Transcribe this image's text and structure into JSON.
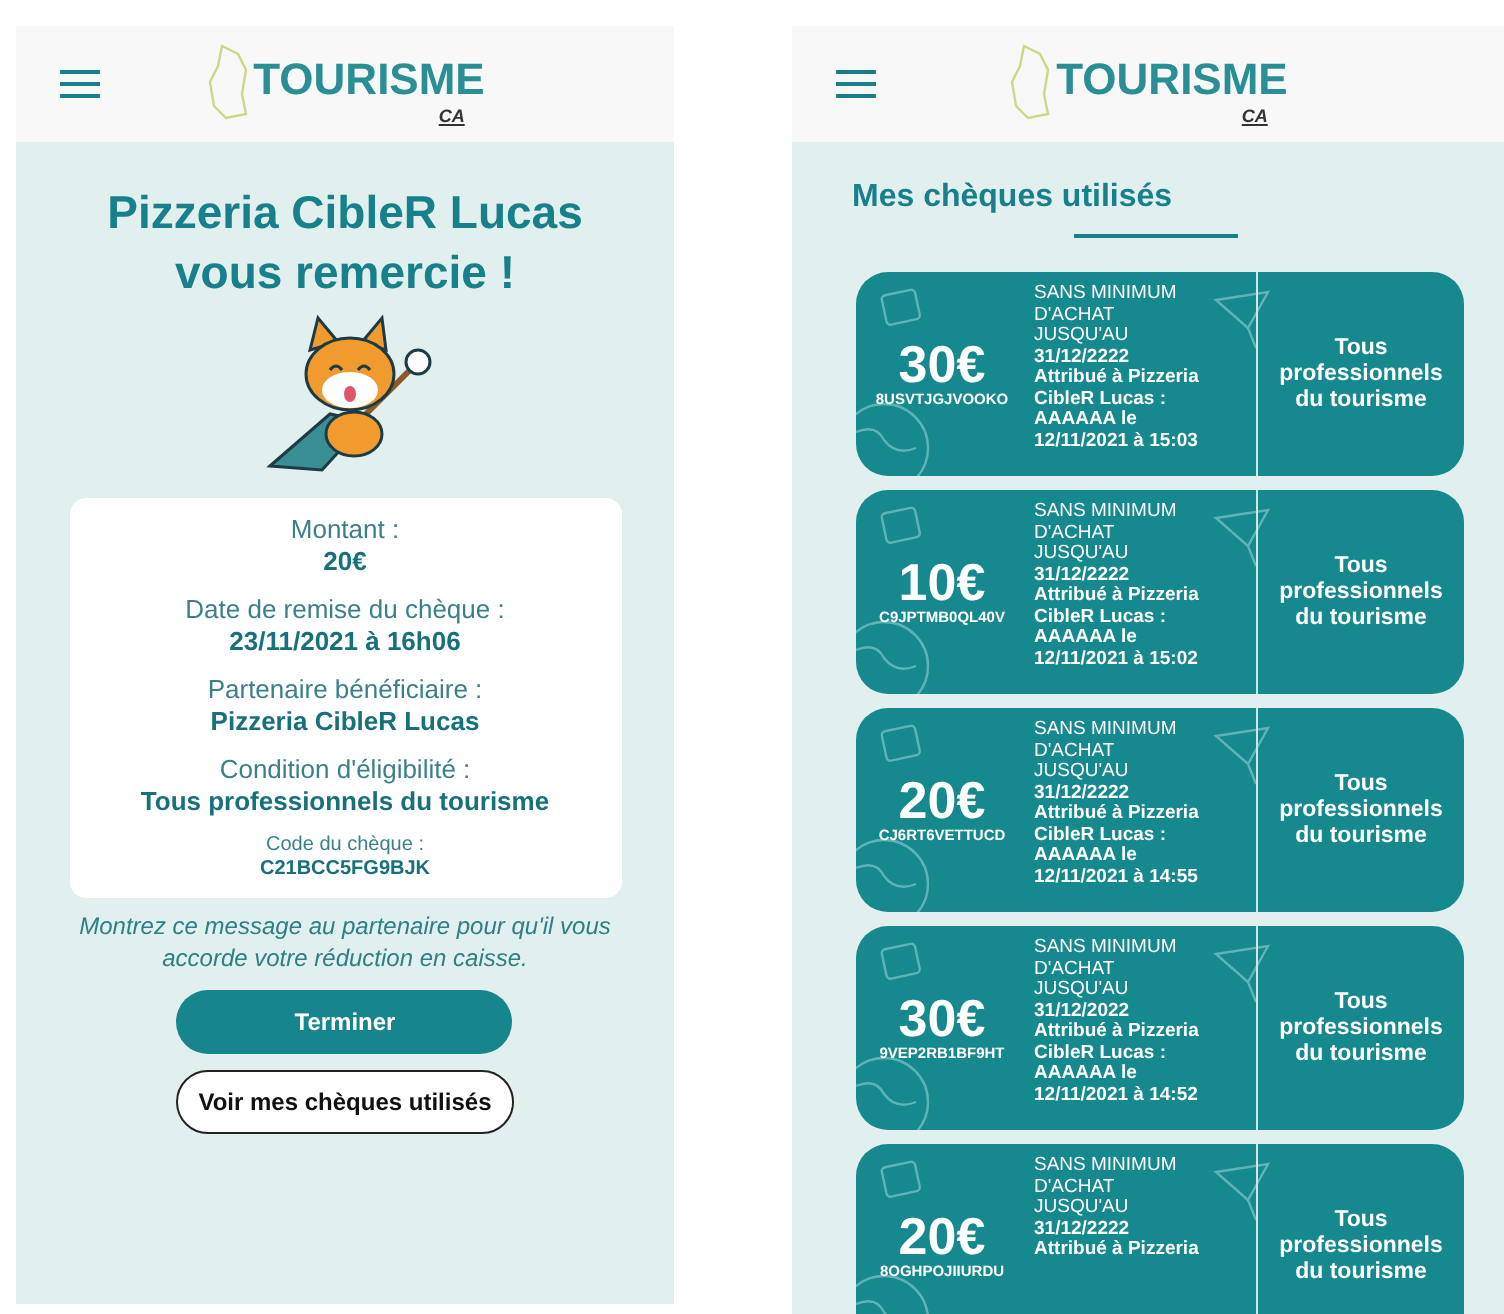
{
  "screens": [
    {
      "kind": "confirmation",
      "logo": {
        "name": "TOURISME",
        "by": "CA"
      },
      "title": "Pizzeria CibleR Lucas vous remercie !",
      "fields": [
        {
          "label": "Montant :",
          "value": "20€"
        },
        {
          "label": "Date de remise du chèque :",
          "value": "23/11/2021 à 16h06"
        },
        {
          "label": "Partenaire bénéficiaire :",
          "value": "Pizzeria CibleR Lucas"
        },
        {
          "label": "Condition d'éligibilité :",
          "value": "Tous professionnels du tourisme"
        }
      ],
      "code": {
        "label": "Code du chèque :",
        "value": "C21BCC5FG9BJK"
      },
      "message": "Montrez ce message au partenaire pour qu'il vous accorde votre réduction en caisse.",
      "buttons": [
        {
          "label": "Terminer",
          "kind": "primary"
        },
        {
          "label": "Voir mes chèques utilisés",
          "kind": "outline"
        }
      ]
    },
    {
      "kind": "list",
      "logo": {
        "name": "TOURISME",
        "by": "CA"
      },
      "title": "Mes chèques utilisés",
      "cheques": [
        {
          "amount": "30€",
          "code": "8USVTJGJVOOKO",
          "condition": [
            "SANS MINIMUM",
            "D'ACHAT",
            "JUSQU'AU"
          ],
          "details": [
            "31/12/2222",
            "Attribué à Pizzeria",
            "CibleR Lucas :",
            "AAAAAA le",
            "12/11/2021 à 15:03"
          ],
          "eligibility": "Tous professionnels du tourisme"
        },
        {
          "amount": "10€",
          "code": "C9JPTMB0QL40V",
          "condition": [
            "SANS MINIMUM",
            "D'ACHAT",
            "JUSQU'AU"
          ],
          "details": [
            "31/12/2222",
            "Attribué à Pizzeria",
            "CibleR Lucas :",
            "AAAAAA le",
            "12/11/2021 à 15:02"
          ],
          "eligibility": "Tous professionnels du tourisme"
        },
        {
          "amount": "20€",
          "code": "CJ6RT6VETTUCD",
          "condition": [
            "SANS MINIMUM",
            "D'ACHAT",
            "JUSQU'AU"
          ],
          "details": [
            "31/12/2222",
            "Attribué à Pizzeria",
            "CibleR Lucas :",
            "AAAAAA le",
            "12/11/2021 à 14:55"
          ],
          "eligibility": "Tous professionnels du tourisme"
        },
        {
          "amount": "30€",
          "code": "9VEP2RB1BF9HT",
          "condition": [
            "SANS MINIMUM",
            "D'ACHAT",
            "JUSQU'AU"
          ],
          "details": [
            "31/12/2022",
            "Attribué à Pizzeria",
            "CibleR Lucas :",
            "AAAAAA le",
            "12/11/2021 à 14:52"
          ],
          "eligibility": "Tous professionnels du tourisme"
        },
        {
          "amount": "20€",
          "code": "8OGHPOJIIURDU",
          "condition": [
            "SANS MINIMUM",
            "D'ACHAT",
            "JUSQU'AU"
          ],
          "details": [
            "31/12/2222",
            "Attribué à Pizzeria"
          ],
          "eligibility": "Tous professionnels du tourisme"
        }
      ]
    }
  ]
}
